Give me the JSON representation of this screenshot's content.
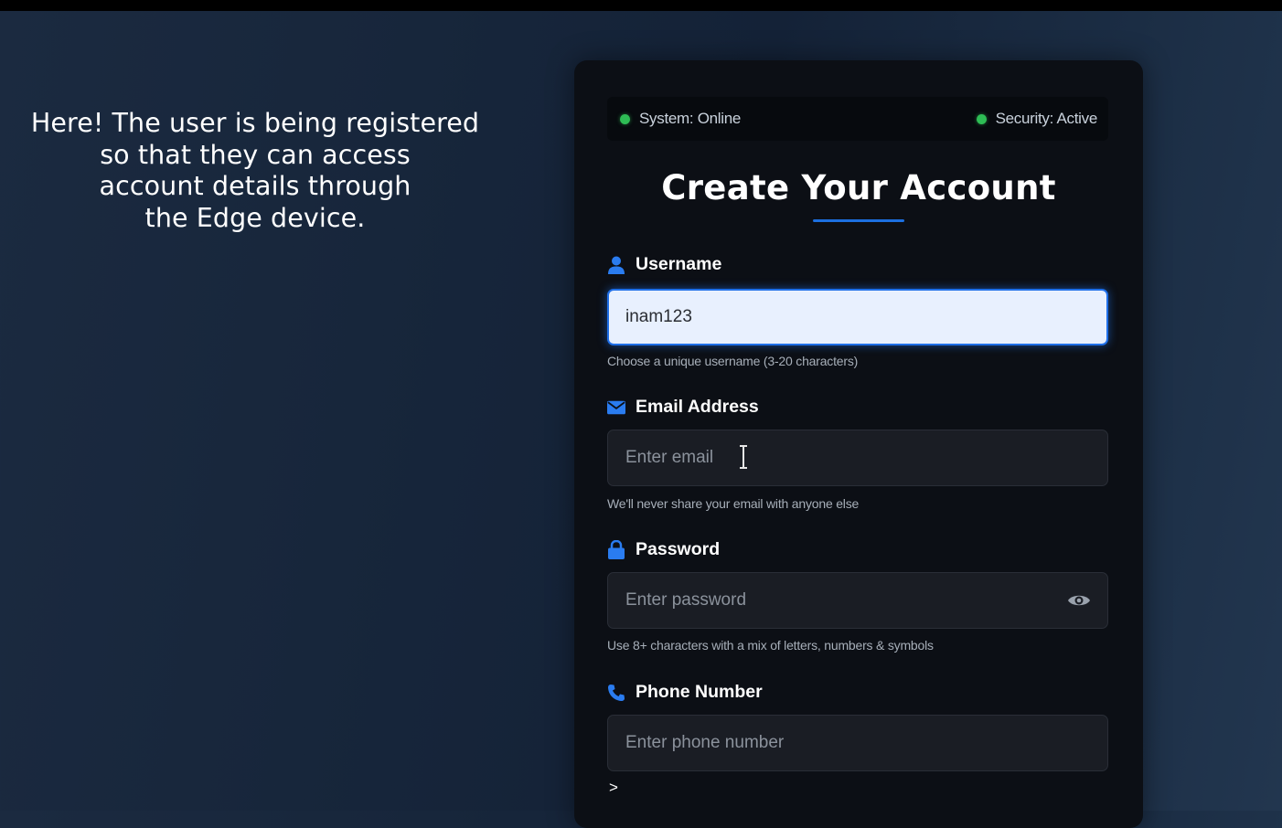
{
  "caption": {
    "lines": [
      "Here! The user is being registered",
      "so that they can access",
      "account details through",
      "the Edge device."
    ]
  },
  "status": {
    "system": "System: Online",
    "security": "Security: Active",
    "indicator_color": "#2ebd55"
  },
  "form": {
    "title": "Create Your Account",
    "accent_color": "#1c6fe0",
    "username": {
      "label": "Username",
      "icon": "user-icon",
      "value": "inam123",
      "hint": "Choose a unique username (3-20 characters)"
    },
    "email": {
      "label": "Email Address",
      "icon": "envelope-icon",
      "placeholder": "Enter email",
      "hint": "We'll never share your email with anyone else"
    },
    "password": {
      "label": "Password",
      "icon": "lock-icon",
      "placeholder": "Enter password",
      "toggle_icon": "eye-icon",
      "hint": "Use 8+ characters with a mix of letters, numbers & symbols"
    },
    "phone": {
      "label": "Phone Number",
      "icon": "phone-icon",
      "placeholder": "Enter phone number"
    },
    "more_marker": ">"
  }
}
